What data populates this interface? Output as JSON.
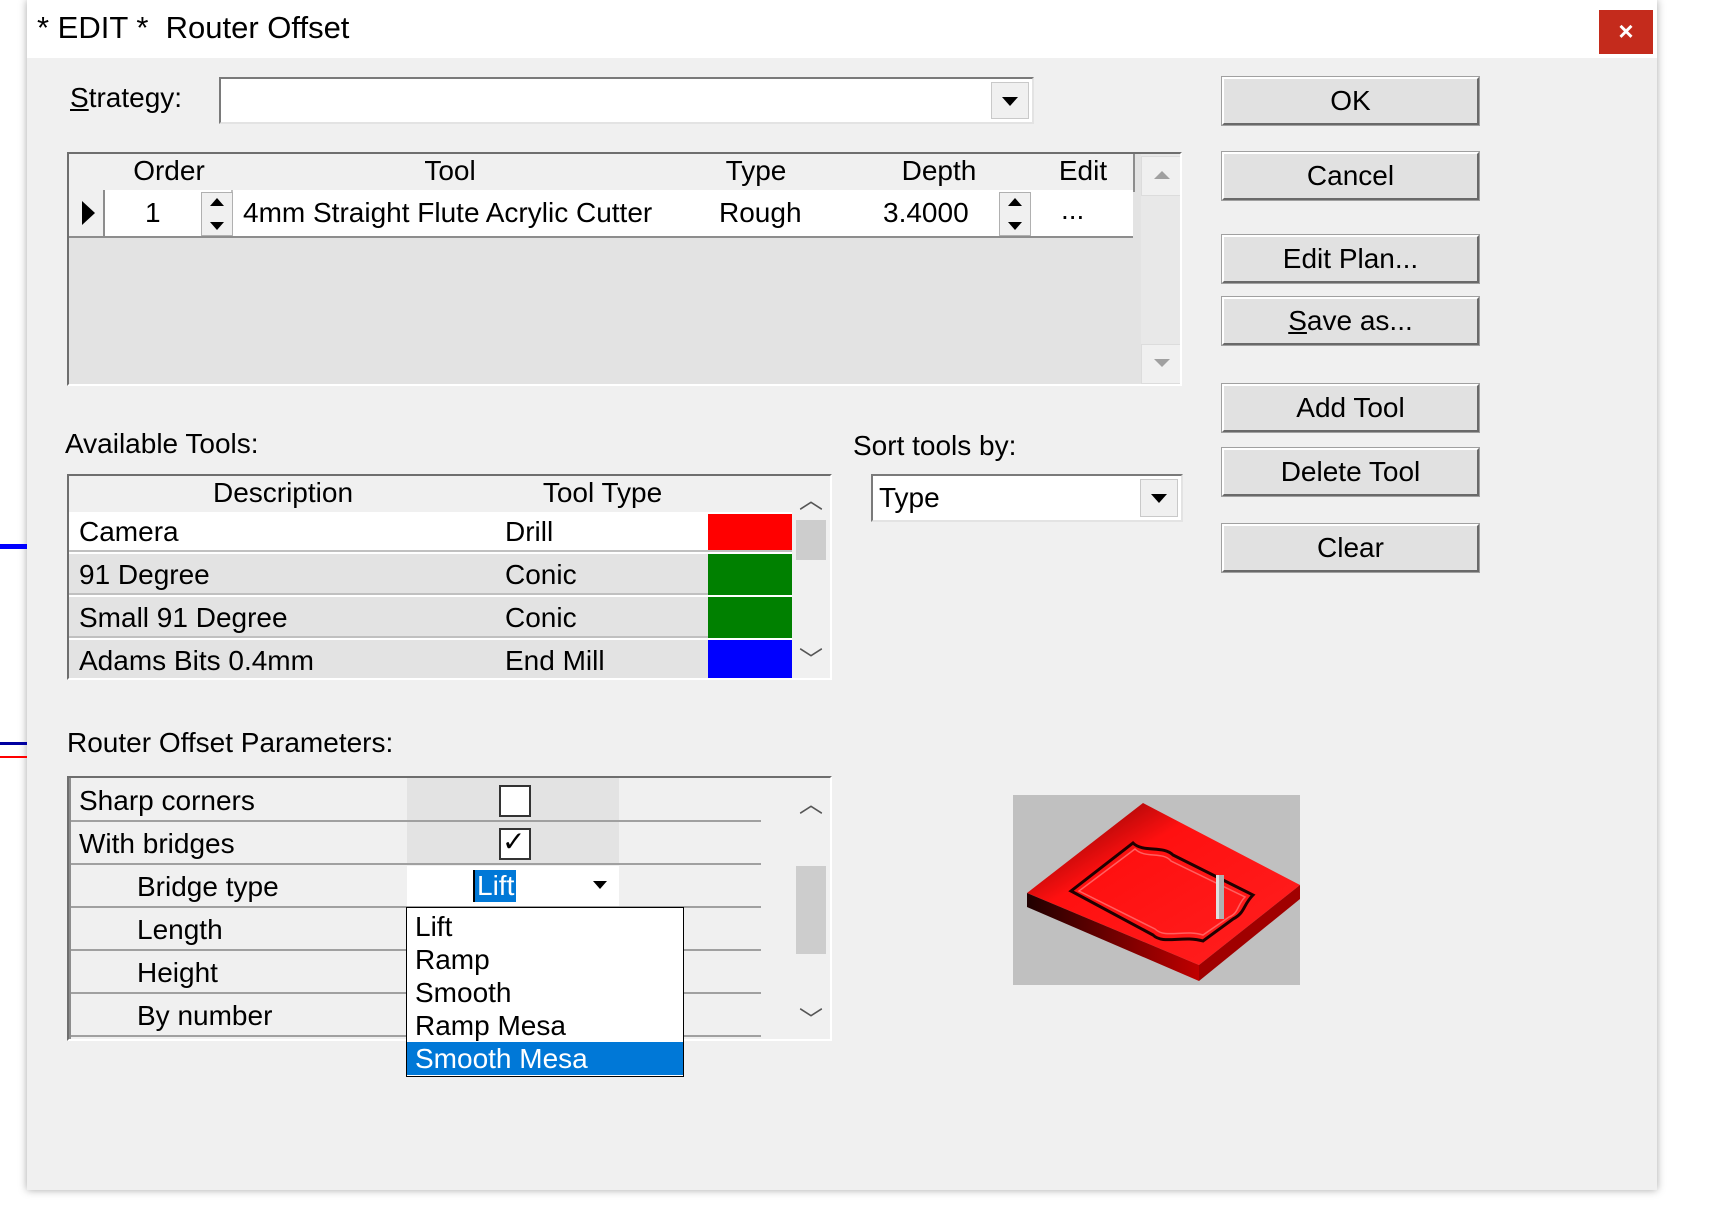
{
  "window": {
    "title": "* EDIT *  Router Offset",
    "close_glyph": "×"
  },
  "strategy": {
    "label_first": "S",
    "label_rest": "trategy:",
    "value": ""
  },
  "plan_grid": {
    "headers": [
      "Order",
      "Tool",
      "Type",
      "Depth",
      "Edit"
    ],
    "rows": [
      {
        "order": "1",
        "tool": "4mm Straight Flute Acrylic Cutter",
        "type": "Rough",
        "depth": "3.4000",
        "edit": "..."
      }
    ]
  },
  "buttons": {
    "ok": "OK",
    "cancel": "Cancel",
    "edit_plan": "Edit Plan...",
    "save_as_first": "S",
    "save_as_rest": "ave as...",
    "add_tool": "Add Tool",
    "delete_tool": "Delete Tool",
    "clear": "Clear"
  },
  "available_tools": {
    "label": "Available Tools:",
    "headers": [
      "Description",
      "Tool Type",
      ""
    ],
    "rows": [
      {
        "description": "Camera",
        "tool_type": "Drill",
        "color": "#ff0000"
      },
      {
        "description": "91 Degree",
        "tool_type": "Conic",
        "color": "#008000"
      },
      {
        "description": "Small 91 Degree",
        "tool_type": "Conic",
        "color": "#008000"
      },
      {
        "description": "Adams Bits 0.4mm",
        "tool_type": "End Mill",
        "color": "#0000ff"
      }
    ]
  },
  "sort": {
    "label": "Sort tools by:",
    "value": "Type"
  },
  "params": {
    "label": "Router Offset Parameters:",
    "rows": [
      {
        "name": "Sharp corners",
        "checked": false
      },
      {
        "name": "With bridges",
        "checked": true
      },
      {
        "name": "Bridge type",
        "value": "Lift"
      },
      {
        "name": "Length"
      },
      {
        "name": "Height"
      },
      {
        "name": "By number"
      }
    ],
    "check_glyph": "✓"
  },
  "bridge_dropdown": {
    "options": [
      "Lift",
      "Ramp",
      "Smooth",
      "Ramp Mesa",
      "Smooth Mesa"
    ],
    "highlighted": "Smooth Mesa"
  },
  "colors": {
    "selection": "#0078d7",
    "close": "#c42b1c",
    "preview_bg": "#c0c0c0",
    "preview_red": "#ff0000"
  }
}
